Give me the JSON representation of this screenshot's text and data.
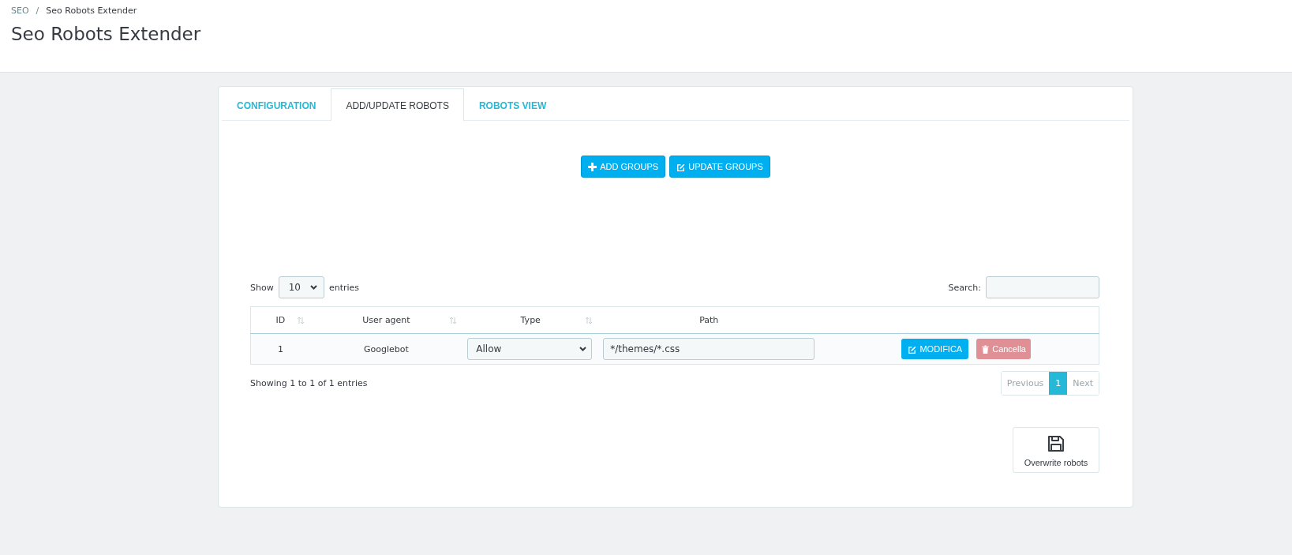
{
  "breadcrumb": [
    {
      "label": "SEO"
    },
    {
      "label": "Seo Robots Extender"
    }
  ],
  "breadcrumb_separator": "/",
  "page_title": "Seo Robots Extender",
  "tabs": [
    {
      "label": "CONFIGURATION",
      "selected": false
    },
    {
      "label": "ADD/UPDATE ROBOTS",
      "selected": true
    },
    {
      "label": "ROBOTS VIEW",
      "selected": false
    }
  ],
  "group_buttons": [
    {
      "label": "ADD GROUPS",
      "kind": "add"
    },
    {
      "label": "UPDATE GROUPS",
      "kind": "edit"
    }
  ],
  "length_control": {
    "prefix": "Show",
    "value": "10",
    "suffix": "entries"
  },
  "search": {
    "label": "Search:"
  },
  "table": {
    "columns": [
      {
        "label": "ID",
        "sortable": true
      },
      {
        "label": "User agent",
        "sortable": true
      },
      {
        "label": "Type",
        "sortable": true
      },
      {
        "label": "Path",
        "sortable": false
      }
    ],
    "rows": [
      {
        "id": "1",
        "user_agent": "Googlebot",
        "type": "Allow",
        "path": "*/themes/*.css",
        "edit_label": "MODIFICA",
        "delete_label": "Cancella"
      }
    ]
  },
  "info": "Showing 1 to 1 of 1 entries",
  "pagination": [
    {
      "label": "Previous",
      "selected": false
    },
    {
      "label": "1",
      "selected": true
    },
    {
      "label": "Next",
      "selected": false
    }
  ],
  "overwrite_button": {
    "label": "Overwrite robots"
  }
}
